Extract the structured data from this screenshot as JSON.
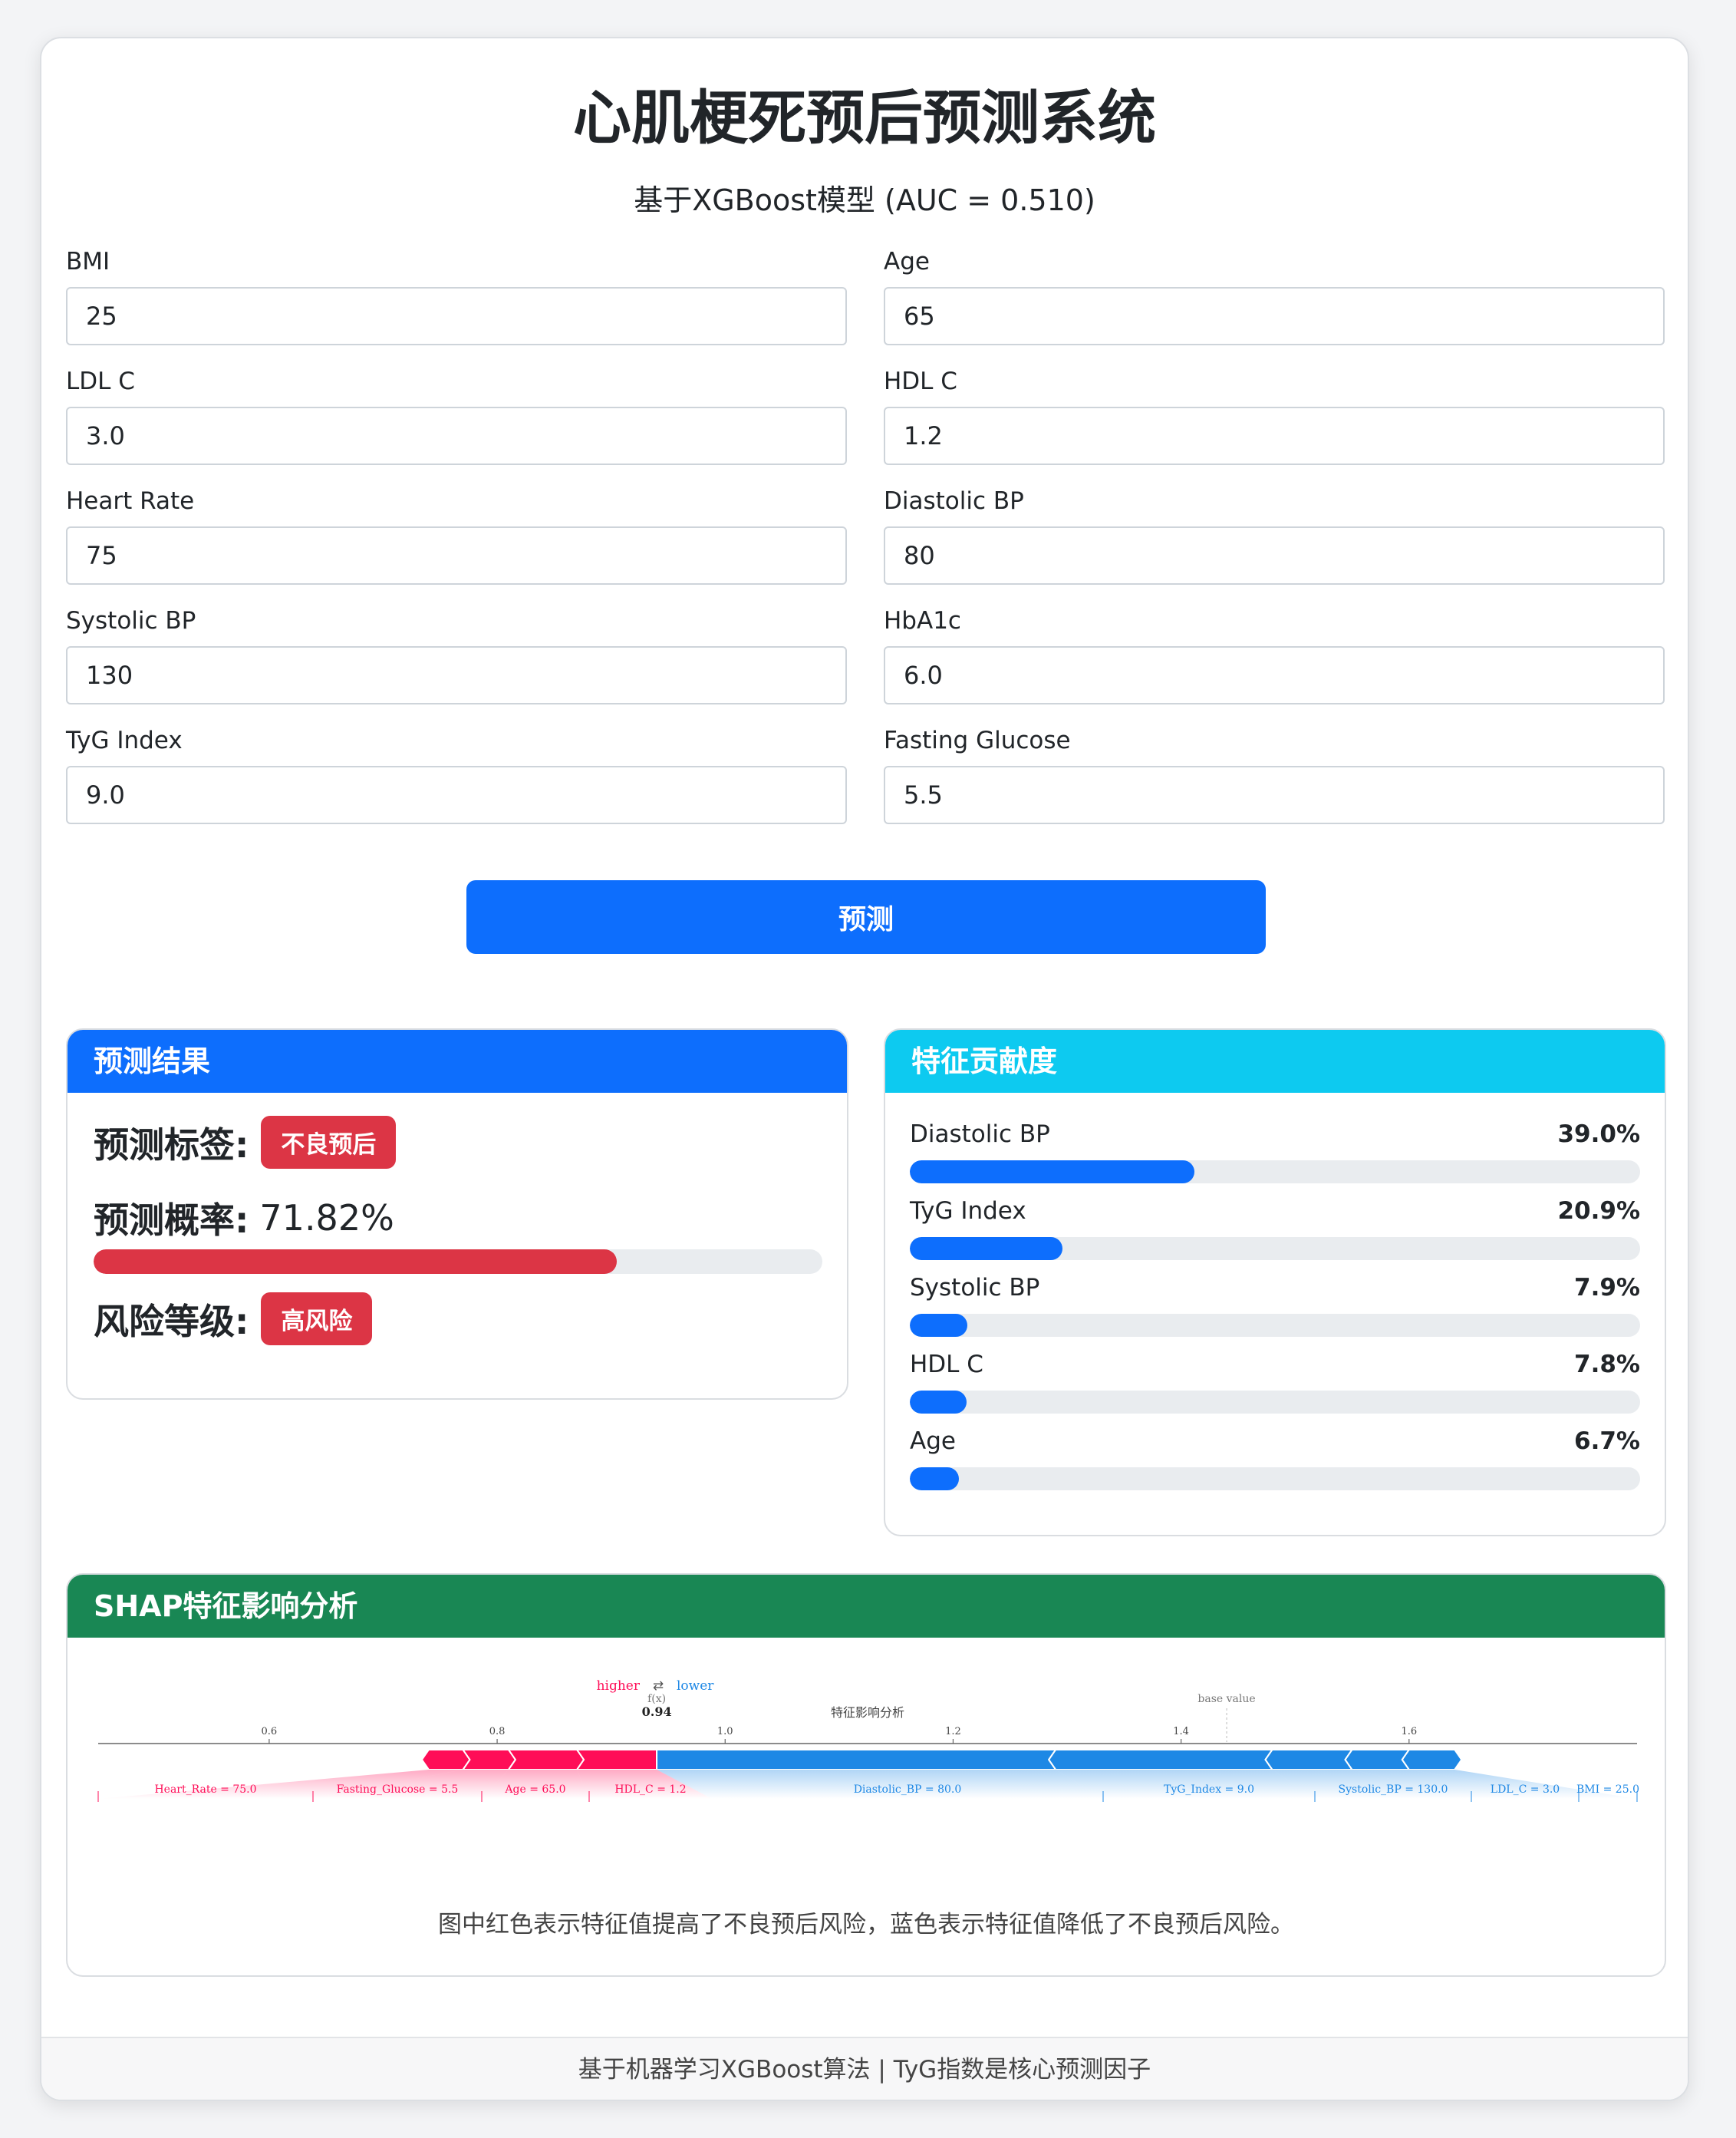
{
  "header": {
    "title": "心肌梗死预后预测系统",
    "subtitle": "基于XGBoost模型 (AUC = 0.510)"
  },
  "form": {
    "fields": [
      {
        "label": "BMI",
        "value": "25"
      },
      {
        "label": "Age",
        "value": "65"
      },
      {
        "label": "LDL C",
        "value": "3.0"
      },
      {
        "label": "HDL C",
        "value": "1.2"
      },
      {
        "label": "Heart Rate",
        "value": "75"
      },
      {
        "label": "Diastolic BP",
        "value": "80"
      },
      {
        "label": "Systolic BP",
        "value": "130"
      },
      {
        "label": "HbA1c",
        "value": "6.0"
      },
      {
        "label": "TyG Index",
        "value": "9.0"
      },
      {
        "label": "Fasting Glucose",
        "value": "5.5"
      }
    ],
    "predict_label": "预测"
  },
  "result": {
    "title": "预测结果",
    "label_text": "预测标签:",
    "label_badge": "不良预后",
    "prob_text": "预测概率:",
    "prob_value": "71.82%",
    "prob_fraction": 0.7182,
    "risk_text": "风险等级:",
    "risk_badge": "高风险"
  },
  "features": {
    "title": "特征贡献度",
    "items": [
      {
        "name": "Diastolic BP",
        "pct": "39.0%",
        "fraction": 0.39
      },
      {
        "name": "TyG Index",
        "pct": "20.9%",
        "fraction": 0.209
      },
      {
        "name": "Systolic BP",
        "pct": "7.9%",
        "fraction": 0.079
      },
      {
        "name": "HDL C",
        "pct": "7.8%",
        "fraction": 0.078
      },
      {
        "name": "Age",
        "pct": "6.7%",
        "fraction": 0.067
      }
    ]
  },
  "shap": {
    "title": "SHAP特征影响分析",
    "plot_title": "特征影响分析",
    "higher": "higher",
    "lower": "lower",
    "arrow": "⇄",
    "fx_label": "f(x)",
    "fx_value": "0.94",
    "base_label": "base value",
    "caption": "图中红色表示特征值提高了不良预后风险，蓝色表示特征值降低了不良预后风险。"
  },
  "chart_data": {
    "type": "force",
    "title": "特征影响分析",
    "x_ticks": [
      "0.6",
      "0.8",
      "1.0",
      "1.2",
      "1.4",
      "1.6"
    ],
    "xlim": [
      0.45,
      1.8
    ],
    "output_value": 0.94,
    "base_value": 1.44,
    "positive": [
      {
        "feature": "Heart_Rate = 75.0",
        "start": 0.74,
        "end": 0.77
      },
      {
        "feature": "Fasting_Glucose = 5.5",
        "start": 0.77,
        "end": 0.81
      },
      {
        "feature": "Age = 65.0",
        "start": 0.81,
        "end": 0.87
      },
      {
        "feature": "HDL_C = 1.2",
        "start": 0.87,
        "end": 0.94
      }
    ],
    "negative": [
      {
        "feature": "Diastolic_BP = 80.0",
        "start": 0.94,
        "end": 1.29
      },
      {
        "feature": "TyG_Index = 9.0",
        "start": 1.29,
        "end": 1.48
      },
      {
        "feature": "Systolic_BP = 130.0",
        "start": 1.48,
        "end": 1.55
      },
      {
        "feature": "LDL_C = 3.0",
        "start": 1.55,
        "end": 1.6
      },
      {
        "feature": "BMI = 25.0",
        "start": 1.6,
        "end": 1.64
      }
    ]
  },
  "colors": {
    "primary": "#0d6efd",
    "info": "#0dcaf0",
    "success": "#198754",
    "danger": "#dc3545",
    "shap_pos": "#ff0d57",
    "shap_neg": "#1e88e5"
  },
  "footer": {
    "text": "基于机器学习XGBoost算法 | TyG指数是核心预测因子"
  }
}
